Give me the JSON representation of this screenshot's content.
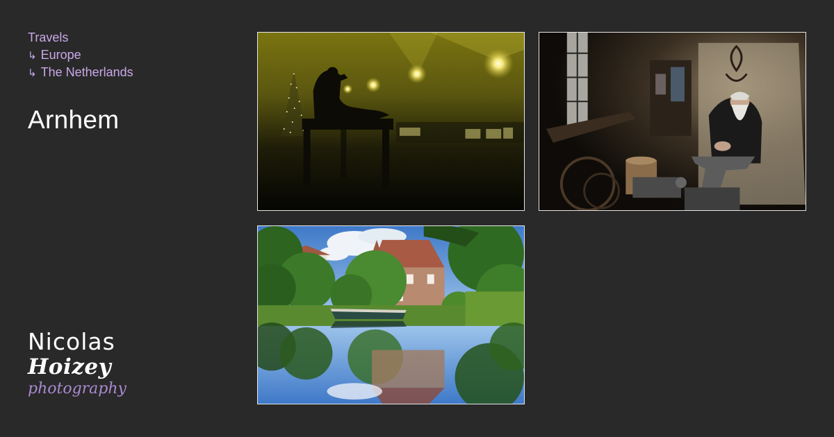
{
  "breadcrumb": {
    "root": "Travels",
    "items": [
      {
        "arrow": "↳",
        "label": "Europe"
      },
      {
        "arrow": "↳",
        "label": "The Netherlands"
      }
    ]
  },
  "page_title": "Arnhem",
  "logo": {
    "first": "Nicolas",
    "last": "Hoizey",
    "sub": "photography"
  },
  "colors": {
    "background": "#292929",
    "link": "#c9a8e8",
    "logo_accent": "#a98ad0",
    "photo_border": "#e8e8e8"
  },
  "photos": [
    {
      "subject": "statue-fog-night"
    },
    {
      "subject": "blacksmith-anvil"
    },
    {
      "subject": "canal-reflection-house"
    }
  ]
}
